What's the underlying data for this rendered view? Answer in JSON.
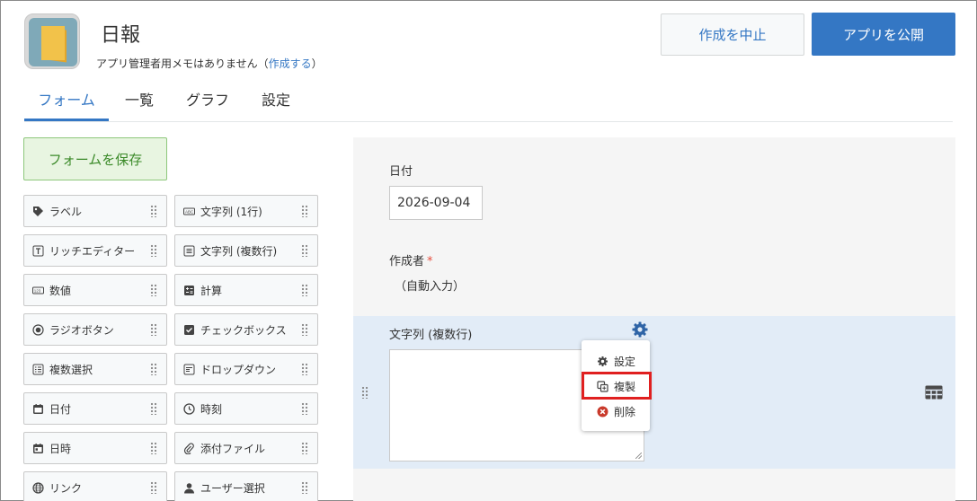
{
  "app": {
    "title": "日報",
    "memo_text": "アプリ管理者用メモはありません（",
    "memo_link": "作成する",
    "memo_close": "）"
  },
  "header": {
    "cancel_label": "作成を中止",
    "publish_label": "アプリを公開"
  },
  "tabs": [
    {
      "label": "フォーム",
      "active": true
    },
    {
      "label": "一覧",
      "active": false
    },
    {
      "label": "グラフ",
      "active": false
    },
    {
      "label": "設定",
      "active": false
    }
  ],
  "sidebar": {
    "save_label": "フォームを保存",
    "items": [
      {
        "label": "ラベル",
        "icon": "tag-icon"
      },
      {
        "label": "文字列 (1行)",
        "icon": "text-single-line-icon"
      },
      {
        "label": "リッチエディター",
        "icon": "rich-text-icon"
      },
      {
        "label": "文字列 (複数行)",
        "icon": "text-multi-line-icon"
      },
      {
        "label": "数値",
        "icon": "number-icon"
      },
      {
        "label": "計算",
        "icon": "calculator-icon"
      },
      {
        "label": "ラジオボタン",
        "icon": "radio-icon"
      },
      {
        "label": "チェックボックス",
        "icon": "checkbox-icon"
      },
      {
        "label": "複数選択",
        "icon": "multi-select-icon"
      },
      {
        "label": "ドロップダウン",
        "icon": "dropdown-icon"
      },
      {
        "label": "日付",
        "icon": "calendar-icon"
      },
      {
        "label": "時刻",
        "icon": "clock-icon"
      },
      {
        "label": "日時",
        "icon": "datetime-icon"
      },
      {
        "label": "添付ファイル",
        "icon": "paperclip-icon"
      },
      {
        "label": "リンク",
        "icon": "globe-icon"
      },
      {
        "label": "ユーザー選択",
        "icon": "user-icon"
      }
    ]
  },
  "form": {
    "date_field": {
      "label": "日付",
      "value": "2026-09-04"
    },
    "creator_field": {
      "label": "作成者",
      "required_mark": "*",
      "value": "（自動入力）"
    },
    "multiline_field": {
      "label": "文字列 (複数行)",
      "value": ""
    }
  },
  "field_menu": {
    "items": [
      {
        "label": "設定",
        "icon": "gear-icon"
      },
      {
        "label": "複製",
        "icon": "duplicate-icon"
      },
      {
        "label": "削除",
        "icon": "delete-icon"
      }
    ]
  },
  "colors": {
    "accent": "#3477c4",
    "save_green": "#3b8a29",
    "highlight_red": "#e02020",
    "selected_row": "#e2ecf7"
  }
}
